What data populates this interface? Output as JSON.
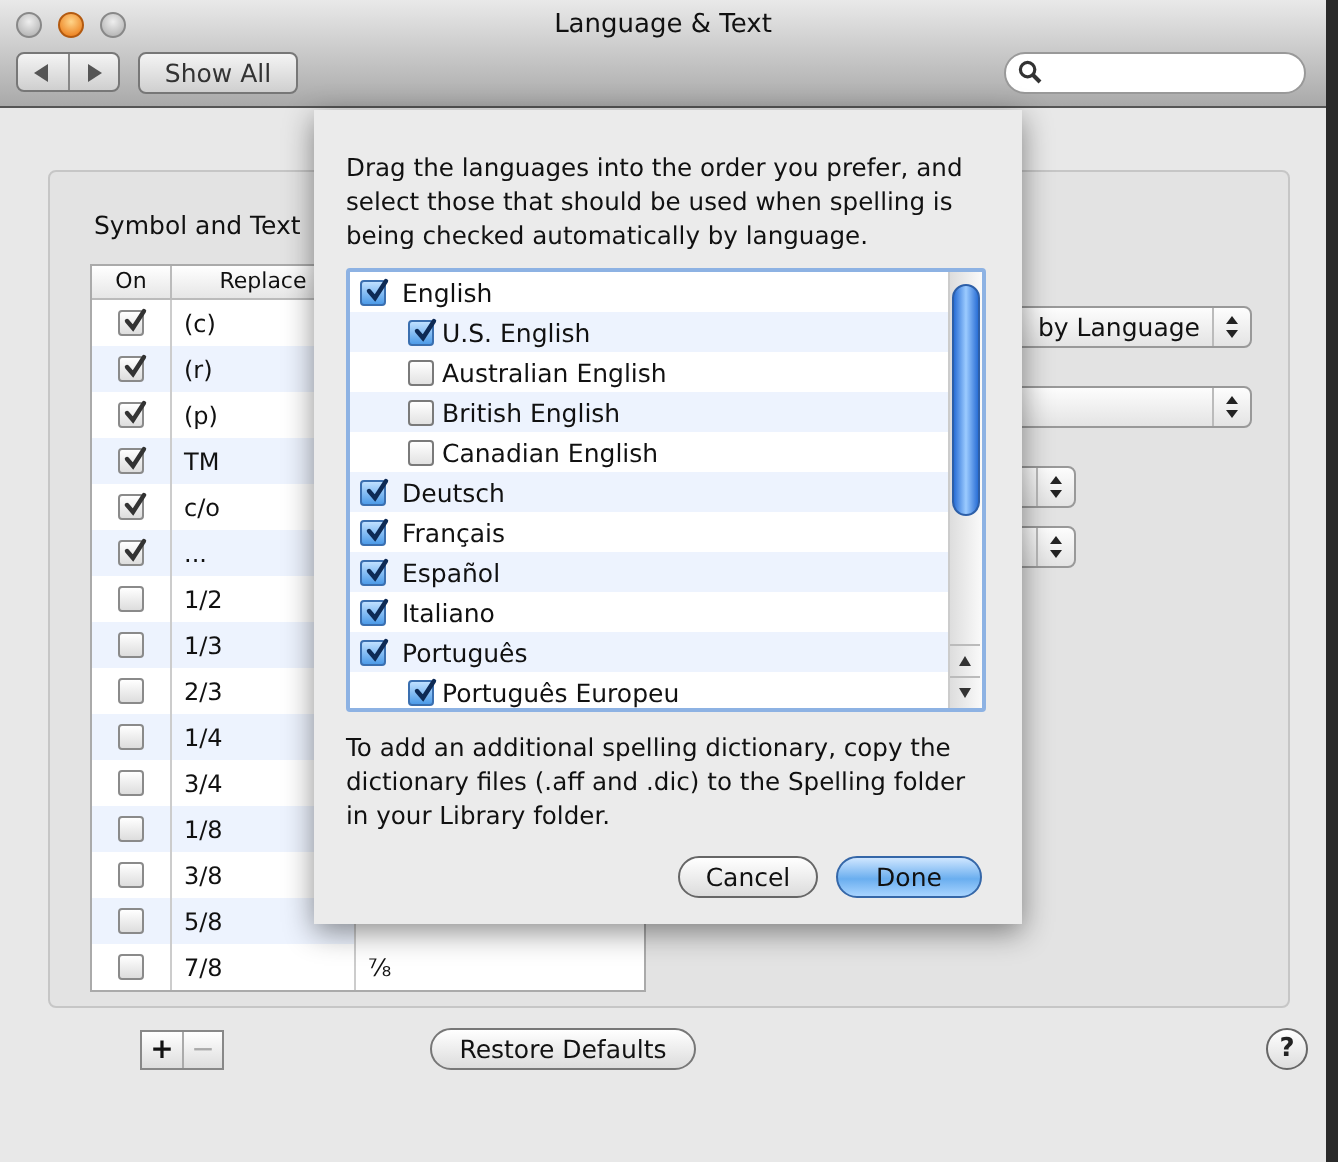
{
  "window": {
    "title": "Language & Text"
  },
  "toolbar": {
    "show_all": "Show All"
  },
  "panel": {
    "title": "Symbol and Text",
    "table": {
      "columns": [
        "On",
        "Replace"
      ],
      "rows": [
        {
          "on": true,
          "replace": "(c)"
        },
        {
          "on": true,
          "replace": "(r)"
        },
        {
          "on": true,
          "replace": "(p)"
        },
        {
          "on": true,
          "replace": "TM"
        },
        {
          "on": true,
          "replace": "c/o"
        },
        {
          "on": true,
          "replace": "..."
        },
        {
          "on": false,
          "replace": "1/2"
        },
        {
          "on": false,
          "replace": "1/3"
        },
        {
          "on": false,
          "replace": "2/3"
        },
        {
          "on": false,
          "replace": "1/4"
        },
        {
          "on": false,
          "replace": "3/4"
        },
        {
          "on": false,
          "replace": "1/8"
        },
        {
          "on": false,
          "replace": "3/8"
        },
        {
          "on": false,
          "replace": "5/8"
        },
        {
          "on": false,
          "replace": "7/8",
          "with": "⅞"
        }
      ]
    },
    "popups": [
      {
        "kind": "wide",
        "value": "by Language"
      },
      {
        "kind": "wide"
      },
      {
        "kind": "small"
      },
      {
        "kind": "small"
      }
    ]
  },
  "bottom": {
    "add": {
      "label": "+",
      "disabled": false
    },
    "remove": {
      "label": "−",
      "disabled": true
    },
    "restore": "Restore Defaults",
    "help": "?"
  },
  "sheet": {
    "description": "Drag the languages into the order you prefer, and select those that should be used when spelling is being checked automatically by language.",
    "languages": [
      {
        "name": "English",
        "checked": true,
        "children": [
          {
            "name": "U.S. English",
            "checked": true
          },
          {
            "name": "Australian English",
            "checked": false
          },
          {
            "name": "British English",
            "checked": false
          },
          {
            "name": "Canadian English",
            "checked": false
          }
        ]
      },
      {
        "name": "Deutsch",
        "checked": true
      },
      {
        "name": "Français",
        "checked": true
      },
      {
        "name": "Español",
        "checked": true
      },
      {
        "name": "Italiano",
        "checked": true
      },
      {
        "name": "Português",
        "checked": true,
        "children": [
          {
            "name": "Português Europeu",
            "checked": true
          }
        ]
      }
    ],
    "note": "To add an additional spelling dictionary, copy the dictionary files (.aff and .dic) to the Spelling folder in your Library folder.",
    "buttons": [
      {
        "label": "Cancel",
        "default": false
      },
      {
        "label": "Done",
        "default": true
      }
    ]
  }
}
